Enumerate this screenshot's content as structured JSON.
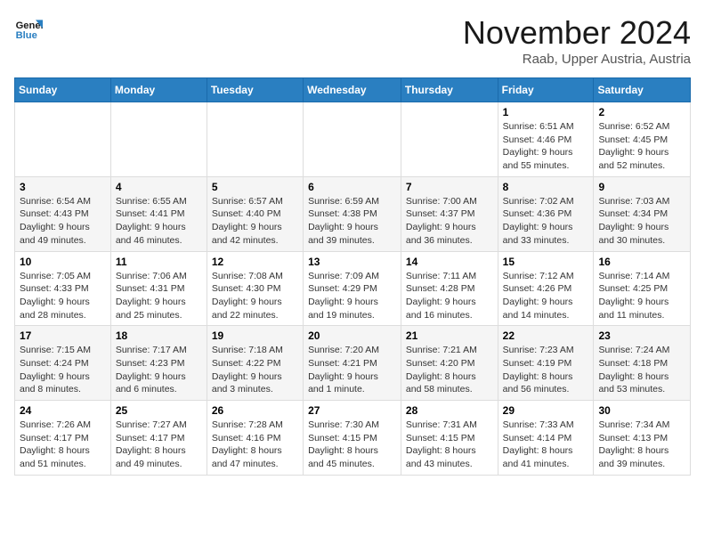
{
  "logo": {
    "line1": "General",
    "line2": "Blue"
  },
  "title": "November 2024",
  "location": "Raab, Upper Austria, Austria",
  "days_header": [
    "Sunday",
    "Monday",
    "Tuesday",
    "Wednesday",
    "Thursday",
    "Friday",
    "Saturday"
  ],
  "weeks": [
    [
      {
        "day": "",
        "info": ""
      },
      {
        "day": "",
        "info": ""
      },
      {
        "day": "",
        "info": ""
      },
      {
        "day": "",
        "info": ""
      },
      {
        "day": "",
        "info": ""
      },
      {
        "day": "1",
        "info": "Sunrise: 6:51 AM\nSunset: 4:46 PM\nDaylight: 9 hours\nand 55 minutes."
      },
      {
        "day": "2",
        "info": "Sunrise: 6:52 AM\nSunset: 4:45 PM\nDaylight: 9 hours\nand 52 minutes."
      }
    ],
    [
      {
        "day": "3",
        "info": "Sunrise: 6:54 AM\nSunset: 4:43 PM\nDaylight: 9 hours\nand 49 minutes."
      },
      {
        "day": "4",
        "info": "Sunrise: 6:55 AM\nSunset: 4:41 PM\nDaylight: 9 hours\nand 46 minutes."
      },
      {
        "day": "5",
        "info": "Sunrise: 6:57 AM\nSunset: 4:40 PM\nDaylight: 9 hours\nand 42 minutes."
      },
      {
        "day": "6",
        "info": "Sunrise: 6:59 AM\nSunset: 4:38 PM\nDaylight: 9 hours\nand 39 minutes."
      },
      {
        "day": "7",
        "info": "Sunrise: 7:00 AM\nSunset: 4:37 PM\nDaylight: 9 hours\nand 36 minutes."
      },
      {
        "day": "8",
        "info": "Sunrise: 7:02 AM\nSunset: 4:36 PM\nDaylight: 9 hours\nand 33 minutes."
      },
      {
        "day": "9",
        "info": "Sunrise: 7:03 AM\nSunset: 4:34 PM\nDaylight: 9 hours\nand 30 minutes."
      }
    ],
    [
      {
        "day": "10",
        "info": "Sunrise: 7:05 AM\nSunset: 4:33 PM\nDaylight: 9 hours\nand 28 minutes."
      },
      {
        "day": "11",
        "info": "Sunrise: 7:06 AM\nSunset: 4:31 PM\nDaylight: 9 hours\nand 25 minutes."
      },
      {
        "day": "12",
        "info": "Sunrise: 7:08 AM\nSunset: 4:30 PM\nDaylight: 9 hours\nand 22 minutes."
      },
      {
        "day": "13",
        "info": "Sunrise: 7:09 AM\nSunset: 4:29 PM\nDaylight: 9 hours\nand 19 minutes."
      },
      {
        "day": "14",
        "info": "Sunrise: 7:11 AM\nSunset: 4:28 PM\nDaylight: 9 hours\nand 16 minutes."
      },
      {
        "day": "15",
        "info": "Sunrise: 7:12 AM\nSunset: 4:26 PM\nDaylight: 9 hours\nand 14 minutes."
      },
      {
        "day": "16",
        "info": "Sunrise: 7:14 AM\nSunset: 4:25 PM\nDaylight: 9 hours\nand 11 minutes."
      }
    ],
    [
      {
        "day": "17",
        "info": "Sunrise: 7:15 AM\nSunset: 4:24 PM\nDaylight: 9 hours\nand 8 minutes."
      },
      {
        "day": "18",
        "info": "Sunrise: 7:17 AM\nSunset: 4:23 PM\nDaylight: 9 hours\nand 6 minutes."
      },
      {
        "day": "19",
        "info": "Sunrise: 7:18 AM\nSunset: 4:22 PM\nDaylight: 9 hours\nand 3 minutes."
      },
      {
        "day": "20",
        "info": "Sunrise: 7:20 AM\nSunset: 4:21 PM\nDaylight: 9 hours\nand 1 minute."
      },
      {
        "day": "21",
        "info": "Sunrise: 7:21 AM\nSunset: 4:20 PM\nDaylight: 8 hours\nand 58 minutes."
      },
      {
        "day": "22",
        "info": "Sunrise: 7:23 AM\nSunset: 4:19 PM\nDaylight: 8 hours\nand 56 minutes."
      },
      {
        "day": "23",
        "info": "Sunrise: 7:24 AM\nSunset: 4:18 PM\nDaylight: 8 hours\nand 53 minutes."
      }
    ],
    [
      {
        "day": "24",
        "info": "Sunrise: 7:26 AM\nSunset: 4:17 PM\nDaylight: 8 hours\nand 51 minutes."
      },
      {
        "day": "25",
        "info": "Sunrise: 7:27 AM\nSunset: 4:17 PM\nDaylight: 8 hours\nand 49 minutes."
      },
      {
        "day": "26",
        "info": "Sunrise: 7:28 AM\nSunset: 4:16 PM\nDaylight: 8 hours\nand 47 minutes."
      },
      {
        "day": "27",
        "info": "Sunrise: 7:30 AM\nSunset: 4:15 PM\nDaylight: 8 hours\nand 45 minutes."
      },
      {
        "day": "28",
        "info": "Sunrise: 7:31 AM\nSunset: 4:15 PM\nDaylight: 8 hours\nand 43 minutes."
      },
      {
        "day": "29",
        "info": "Sunrise: 7:33 AM\nSunset: 4:14 PM\nDaylight: 8 hours\nand 41 minutes."
      },
      {
        "day": "30",
        "info": "Sunrise: 7:34 AM\nSunset: 4:13 PM\nDaylight: 8 hours\nand 39 minutes."
      }
    ]
  ]
}
